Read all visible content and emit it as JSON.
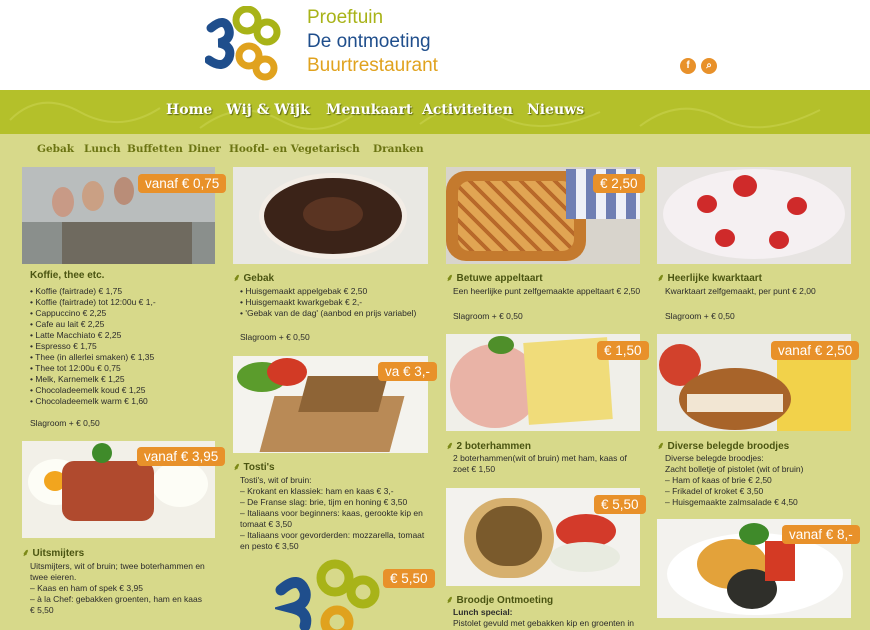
{
  "brand": {
    "line1": "Proeftuin",
    "line2": "De ontmoeting",
    "line3": "Buurtrestaurant"
  },
  "social": [
    {
      "icon": "facebook-icon",
      "glyph": "f"
    },
    {
      "icon": "search-icon",
      "glyph": "⌕"
    }
  ],
  "nav": [
    "Home",
    "Wij & Wijk",
    "Menukaart",
    "Activiteiten",
    "Nieuws"
  ],
  "subnav": [
    "Gebak",
    "Lunch",
    "Buffetten",
    "Diner",
    "Hoofd- en Vegetarisch",
    "Dranken"
  ],
  "colors": {
    "accent": "#e8912a",
    "brand_green": "#b4c02a",
    "brand_blue": "#1f4e8c",
    "brand_gold": "#e0a21e"
  },
  "cards": {
    "koffie": {
      "price": "vanaf € 0,75",
      "title": "Koffie, thee etc.",
      "items": [
        "• Koffie (fairtrade) € 1,75",
        "• Koffie (fairtrade) tot 12:00u € 1,-",
        "• Cappuccino € 2,25",
        "• Cafe au lait € 2,25",
        "• Latte Macchiato € 2,25",
        "• Espresso € 1,75",
        "• Thee (in allerlei smaken) € 1,35",
        "• Thee tot 12:00u € 0,75",
        "• Melk, Karnemelk € 1,25",
        "• Chocoladeemelk koud € 1,25",
        "• Chocoladeemelk warm € 1,60"
      ],
      "extra": "Slagroom + € 0,50"
    },
    "gebak": {
      "title": "Gebak",
      "items": [
        "• Huisgemaakt appelgebak € 2,50",
        "• Huisgemaakt kwarkgebak € 2,-",
        "• 'Gebak van de dag' (aanbod en prijs variabel)"
      ],
      "extra": "Slagroom + € 0,50"
    },
    "appeltaart": {
      "price": "€ 2,50",
      "title": "Betuwe appeltaart",
      "text": "Een heerlijke punt zelfgemaakte appeltaart € 2,50",
      "extra": "Slagroom + € 0,50"
    },
    "kwarktaart": {
      "title": "Heerlijke kwarktaart",
      "text": "Kwarktaart zelfgemaakt, per punt € 2,00",
      "extra": "Slagroom + € 0,50"
    },
    "uitsmijters": {
      "price": "vanaf € 3,95",
      "title": "Uitsmijters",
      "items": [
        "Uitsmijters, wit of bruin; twee boterhammen en",
        "twee eieren.",
        "– Kaas en ham of spek € 3,95",
        "– à la Chef: gebakken groenten, ham en kaas",
        "€ 5,50"
      ]
    },
    "tostis": {
      "price": "va € 3,-",
      "title": "Tosti's",
      "items": [
        "Tosti's, wit of bruin:",
        "– Krokant en klassiek: ham en kaas € 3,-",
        "– De Franse slag: brie, tijm en honing € 3,50",
        "– Italiaans voor beginners: kaas, gerookte kip en",
        "tomaat € 3,50",
        "– Italiaans voor gevorderden: mozzarella, tomaat",
        "en pesto € 3,50"
      ]
    },
    "boterhammen": {
      "price": "€ 1,50",
      "title": "2 boterhammen",
      "items": [
        "2 boterhammen(wit of bruin) met ham, kaas of",
        "zoet € 1,50"
      ]
    },
    "broodjes": {
      "price": "vanaf € 2,50",
      "title": "Diverse belegde broodjes",
      "items": [
        "Diverse belegde broodjes:",
        "Zacht bolletje of pistolet (wit of bruin)",
        "– Ham of kaas of brie € 2,50",
        "– Frikadel of kroket € 3,50",
        "– Huisgemaakte zalmsalade € 4,50"
      ]
    },
    "ontmoeting": {
      "price": "€ 5,50",
      "title": "Broodje Ontmoeting",
      "subtitle": "Lunch special:",
      "text": "Pistolet gevuld met gebakken kip en groenten in"
    },
    "dagmenu": {
      "price": "vanaf € 8,-"
    },
    "logo2": {
      "price": "€ 5,50"
    }
  }
}
